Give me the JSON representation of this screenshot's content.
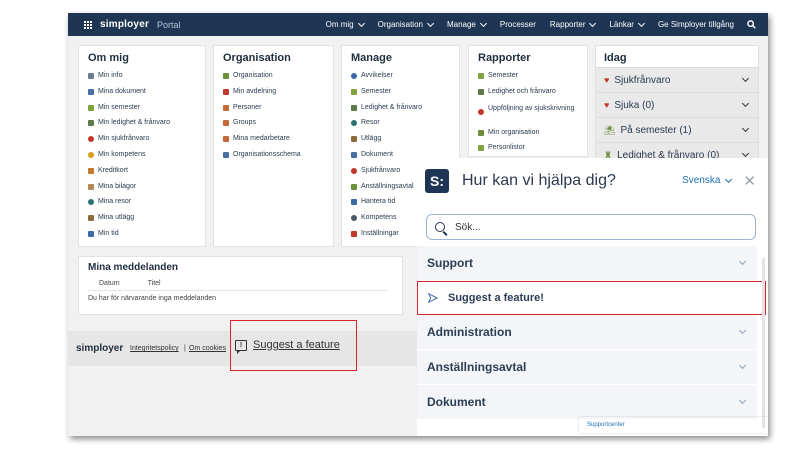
{
  "header": {
    "brand": "simployer",
    "portal": "Portal",
    "nav": [
      "Om mig",
      "Organisation",
      "Manage",
      "Processer",
      "Rapporter",
      "Länkar",
      "Ge Simployer tillgång"
    ]
  },
  "cards": {
    "om_mig": {
      "title": "Om mig",
      "items": [
        "Min info",
        "Mina dokument",
        "Min semester",
        "Min ledighet & frånvaro",
        "Min sjukfrånvaro",
        "Min kompetens",
        "Kreditkort",
        "Mina bilagor",
        "Mina resor",
        "Mina utlägg",
        "Min tid"
      ]
    },
    "organisation": {
      "title": "Organisation",
      "items": [
        "Organisation",
        "Min avdelning",
        "Personer",
        "Groups",
        "Mina medarbetare",
        "Organisationsschema"
      ]
    },
    "manage": {
      "title": "Manage",
      "items": [
        "Avvikelser",
        "Semester",
        "Ledighet & frånvaro",
        "Resor",
        "Utlägg",
        "Dokument",
        "Sjukfrånvaro",
        "Anställningsavtal",
        "Hantera tid",
        "Kompetens",
        "Inställningar"
      ]
    },
    "rapporter": {
      "title": "Rapporter",
      "items": [
        "Semester",
        "Ledighet och frånvaro",
        "Uppföljning av sjukskrivning",
        "Min organisation",
        "Personlistor"
      ]
    }
  },
  "idag": {
    "title": "Idag",
    "rows": [
      "Sjukfrånvaro",
      "Sjuka (0)",
      "På semester (1)",
      "Ledighet & frånvaro (0)"
    ]
  },
  "messages": {
    "title": "Mina meddelanden",
    "col_datum": "Datum",
    "col_titel": "Titel",
    "empty": "Du har för närvarande inga meddelanden"
  },
  "footer": {
    "logo": "simployer",
    "privacy": "Integritetspolicy",
    "separator": "|",
    "cookies": "Om cookies",
    "suggest": "Suggest a feature"
  },
  "help": {
    "logo_letter": "S:",
    "title": "Hur kan vi hjälpa dig?",
    "language": "Svenska",
    "close": "✕",
    "search_placeholder": "Sök...",
    "sections": [
      "Support",
      "Suggest a feature!",
      "Administration",
      "Anställningsavtal",
      "Dokument"
    ],
    "footer_link": "Supportcenter"
  },
  "colors": {
    "navy": "#1f3554",
    "highlight": "#d9232d",
    "link": "#1f6fb2"
  },
  "icons": [
    "grid-icon",
    "search-icon",
    "chevron-down-icon",
    "heart-icon",
    "send-icon",
    "feedback-icon",
    "close-icon"
  ]
}
